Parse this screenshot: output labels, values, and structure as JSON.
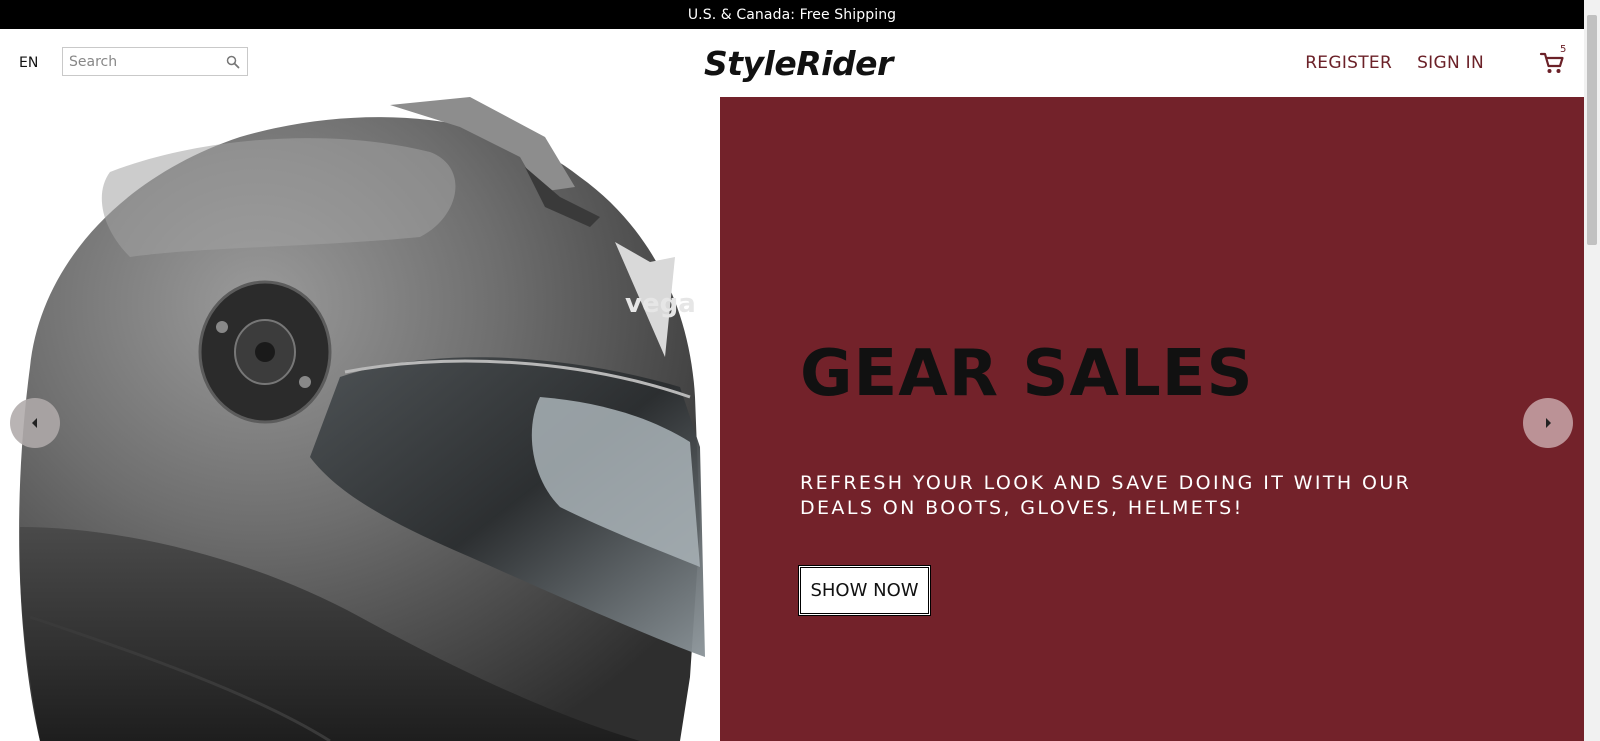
{
  "announcement": {
    "text": "U.S. & Canada: Free Shipping"
  },
  "header": {
    "language": "EN",
    "search": {
      "placeholder": "Search",
      "value": ""
    },
    "logo": "StyleRider",
    "register_label": "REGISTER",
    "signin_label": "SIGN IN",
    "cart_count": "5"
  },
  "hero": {
    "title": "GEAR SALES",
    "subtitle": "REFRESH YOUR LOOK AND SAVE DOING IT WITH OUR DEALS ON BOOTS, GLOVES, HELMETS!",
    "button_label": "SHOW NOW",
    "helmet_brand": "vega",
    "panel_color": "#73222a"
  },
  "colors": {
    "accent": "#6b2128",
    "announce_bg": "#000000"
  },
  "icons": [
    "search-icon",
    "cart-icon",
    "chevron-left-icon",
    "chevron-right-icon"
  ]
}
